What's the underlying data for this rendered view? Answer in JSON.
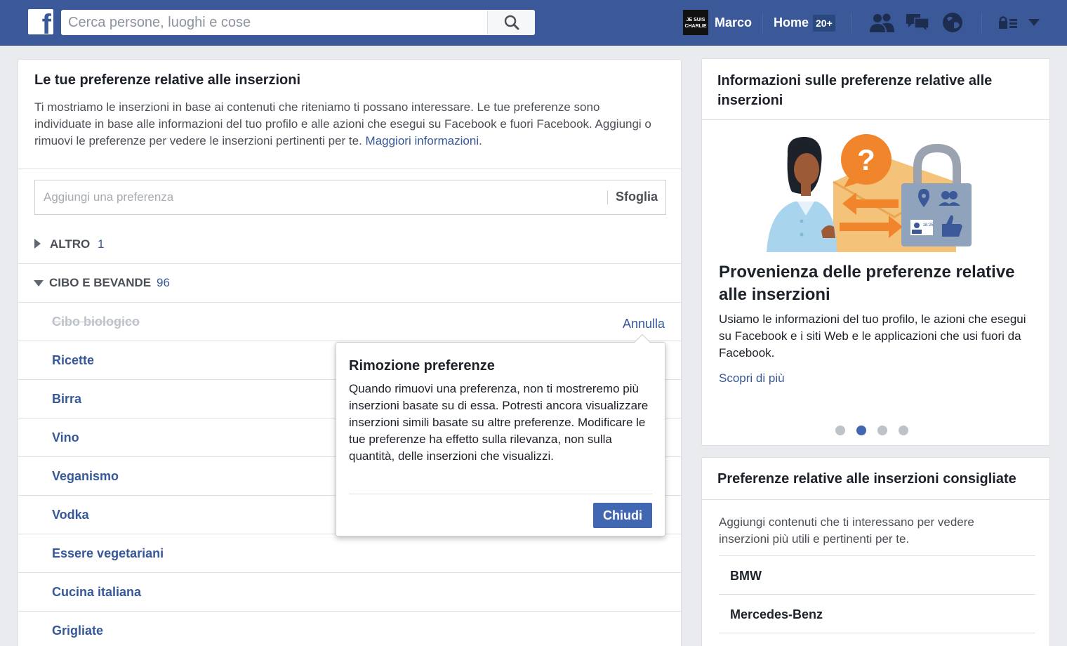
{
  "topbar": {
    "logo": "f",
    "search_placeholder": "Cerca persone, luoghi e cose",
    "profile_thumb_text": "JE SUIS CHARLIE",
    "profile_name": "Marco",
    "home_label": "Home",
    "home_badge": "20+",
    "icons": [
      "friends-icon",
      "messages-icon",
      "globe-icon",
      "privacy-lock-icon",
      "dropdown-arrow-icon"
    ],
    "brand_color": "#3b5998"
  },
  "main": {
    "title": "Le tue preferenze relative alle inserzioni",
    "description": "Ti mostriamo le inserzioni in base ai contenuti che riteniamo ti possano interessare. Le tue preferenze sono individuate in base alle informazioni del tuo profilo e alle azioni che esegui su Facebook e fuori Facebook. Aggiungi o rimuovi le preferenze per vedere le inserzioni pertinenti per te.",
    "more_info_link": "Maggiori informazioni",
    "description_end": ".",
    "pref_input_placeholder": "Aggiungi una preferenza",
    "browse_label": "Sfoglia",
    "categories": [
      {
        "label": "ALTRO",
        "count": "1",
        "expanded": false
      },
      {
        "label": "CIBO E BEVANDE",
        "count": "96",
        "expanded": true
      }
    ],
    "items": [
      {
        "label": "Cibo biologico",
        "removed": true
      },
      {
        "label": "Ricette"
      },
      {
        "label": "Birra"
      },
      {
        "label": "Vino"
      },
      {
        "label": "Veganismo"
      },
      {
        "label": "Vodka"
      },
      {
        "label": "Essere vegetariani"
      },
      {
        "label": "Cucina italiana"
      },
      {
        "label": "Grigliate"
      }
    ],
    "undo_label": "Annulla"
  },
  "popover": {
    "title": "Rimozione preferenze",
    "body": "Quando rimuovi una preferenza, non ti mostreremo più inserzioni basate su di essa. Potresti ancora visualizzare inserzioni simili basate su altre preferenze. Modificare le tue preferenze ha effetto sulla rilevanza, non sulla quantità, delle inserzioni che visualizzi.",
    "close_label": "Chiudi"
  },
  "info_card": {
    "title": "Informazioni sulle preferenze relative alle inserzioni",
    "carousel_title": "Provenienza delle preferenze relative alle inserzioni",
    "carousel_desc": "Usiamo le informazioni del tuo profilo, le azioni che esegui su Facebook e i siti Web e le applicazioni che usi fuori da Facebook.",
    "learn_more": "Scopri di più",
    "illustration_badge": "18:25",
    "slide_count": 4,
    "active_slide": 2
  },
  "suggestions": {
    "title": "Preferenze relative alle inserzioni consigliate",
    "description": "Aggiungi contenuti che ti interessano per vedere inserzioni più utili e pertinenti per te.",
    "items": [
      "BMW",
      "Mercedes-Benz"
    ]
  }
}
